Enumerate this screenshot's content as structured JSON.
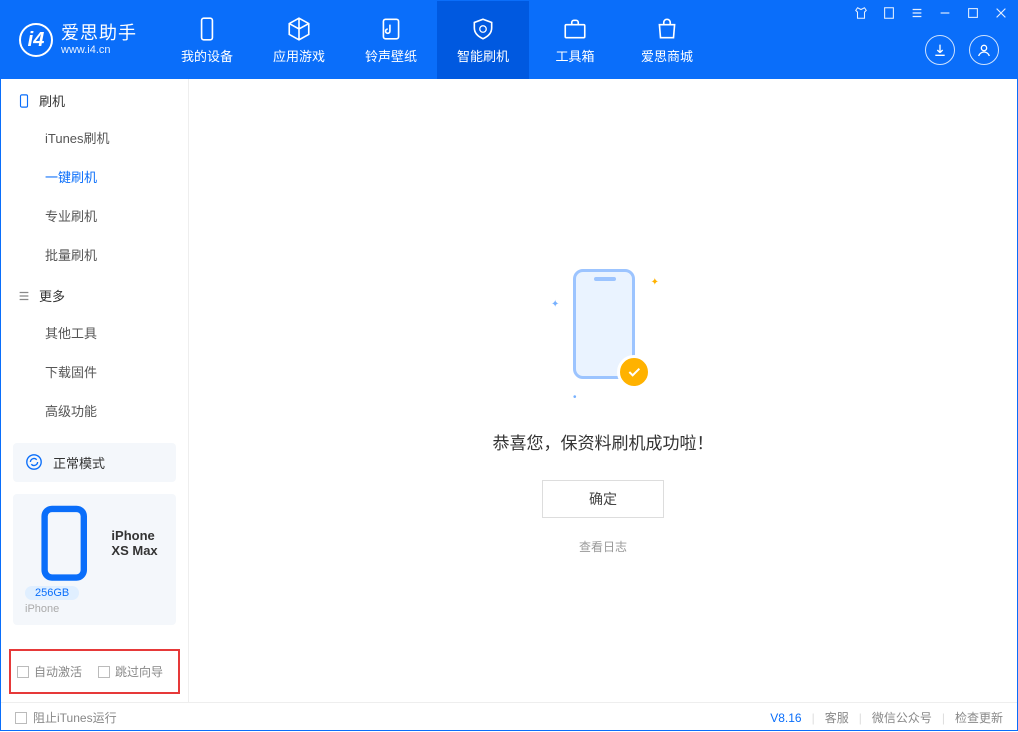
{
  "app": {
    "name_cn": "爱思助手",
    "name_en": "www.i4.cn"
  },
  "tabs": [
    {
      "label": "我的设备"
    },
    {
      "label": "应用游戏"
    },
    {
      "label": "铃声壁纸"
    },
    {
      "label": "智能刷机"
    },
    {
      "label": "工具箱"
    },
    {
      "label": "爱思商城"
    }
  ],
  "sidebar": {
    "group1": {
      "title": "刷机",
      "items": [
        "iTunes刷机",
        "一键刷机",
        "专业刷机",
        "批量刷机"
      ]
    },
    "group2": {
      "title": "更多",
      "items": [
        "其他工具",
        "下载固件",
        "高级功能"
      ]
    }
  },
  "mode": {
    "label": "正常模式"
  },
  "device": {
    "name": "iPhone XS Max",
    "storage": "256GB",
    "type": "iPhone"
  },
  "options": {
    "auto_activate": "自动激活",
    "skip_guide": "跳过向导"
  },
  "main": {
    "success": "恭喜您，保资料刷机成功啦！",
    "ok": "确定",
    "view_log": "查看日志"
  },
  "footer": {
    "block_itunes": "阻止iTunes运行",
    "version": "V8.16",
    "links": [
      "客服",
      "微信公众号",
      "检查更新"
    ]
  }
}
